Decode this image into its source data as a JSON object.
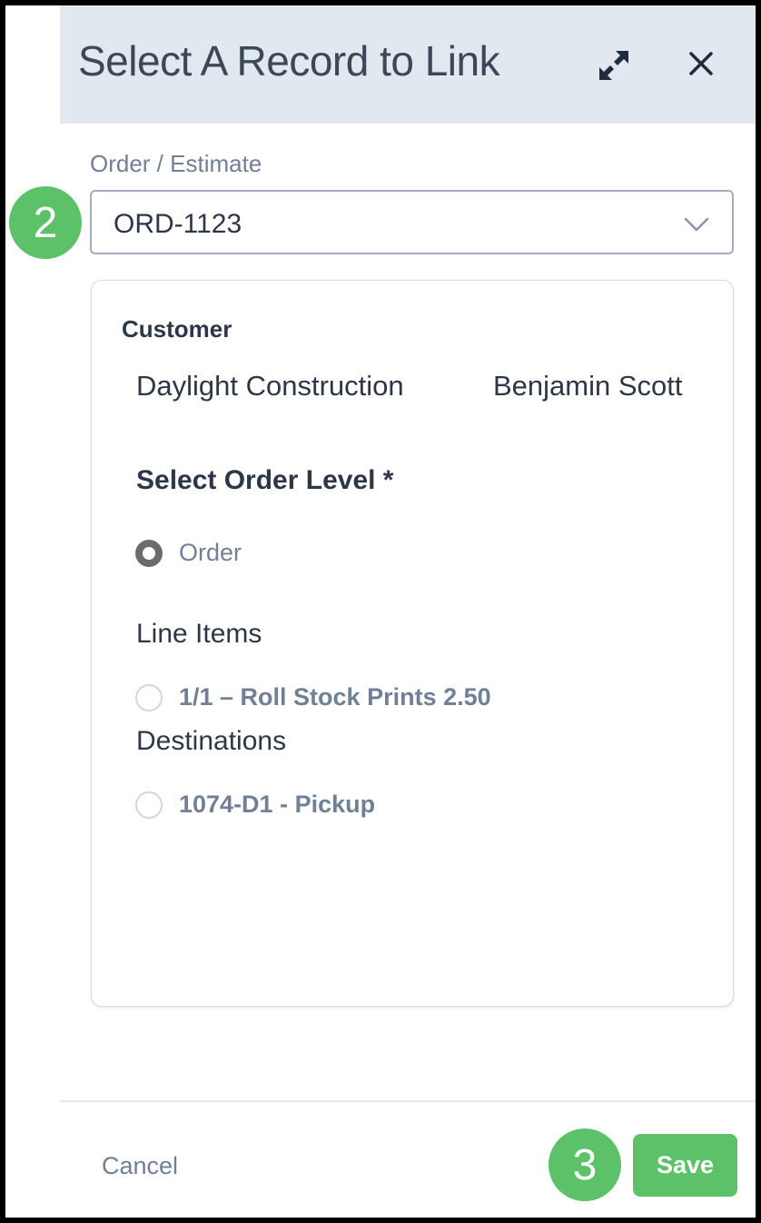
{
  "dialog": {
    "title": "Select A Record to Link",
    "expand_icon": "expand-arrows-icon",
    "close_icon": "close-icon"
  },
  "field": {
    "label": "Order / Estimate",
    "value": "ORD-1123",
    "chevron_icon": "chevron-down-icon"
  },
  "steps": {
    "select_step": "2",
    "save_step": "3"
  },
  "customer": {
    "heading": "Customer",
    "company": "Daylight Construction",
    "contact": "Benjamin Scott"
  },
  "order_level": {
    "heading": "Select Order Level *",
    "order_option": {
      "label": "Order",
      "selected": true
    },
    "line_items_label": "Line Items",
    "line_items": [
      {
        "label": "1/1 – Roll Stock Prints 2.50",
        "selected": false
      }
    ],
    "destinations_label": "Destinations",
    "destinations": [
      {
        "label": "1074-D1 - Pickup",
        "selected": false
      }
    ]
  },
  "footer": {
    "cancel_label": "Cancel",
    "save_label": "Save"
  },
  "colors": {
    "header_bg": "#e2e8f0",
    "accent_green": "#5cc169",
    "text_dark": "#2d3748",
    "text_muted": "#718096"
  }
}
